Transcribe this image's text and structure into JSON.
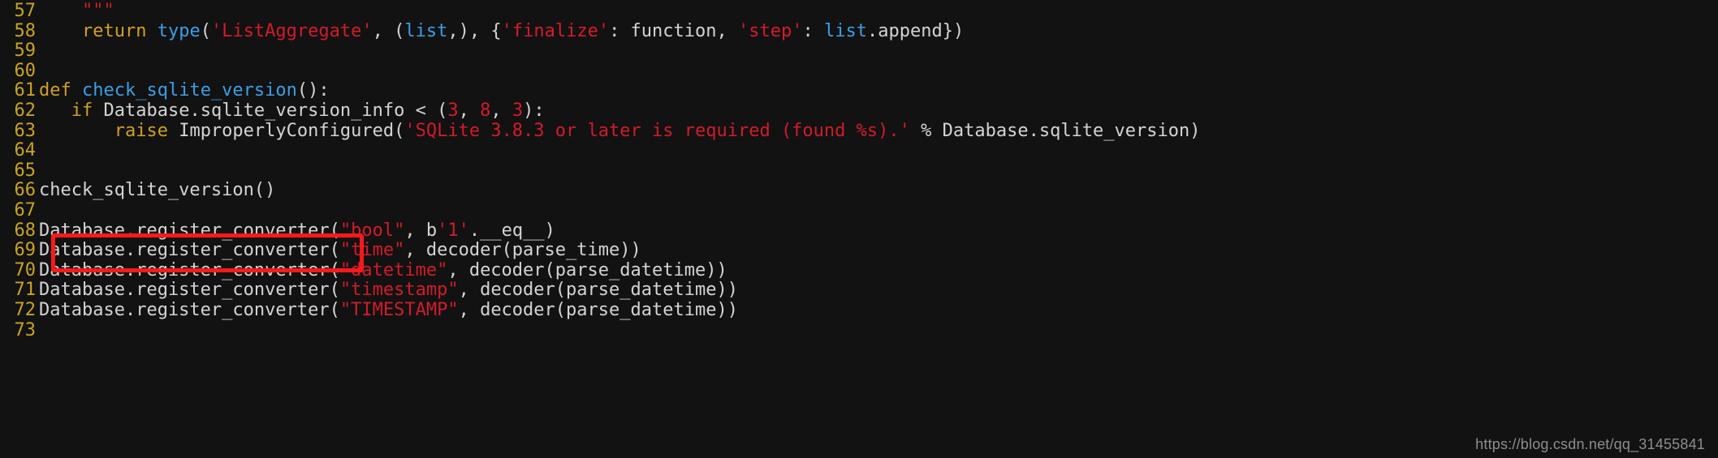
{
  "editor": {
    "language": "python",
    "background_color": "#121212",
    "gutter_color": "#c8a422",
    "default_text_color": "#d4d4d4",
    "keyword_color": "#cfa023",
    "string_color": "#d01c2a",
    "number_color": "#d01c2a",
    "function_color": "#3c9ee5",
    "first_line_number": 57,
    "last_line_number": 73
  },
  "annotation": {
    "type": "rectangle",
    "color": "#ff1a1a",
    "target_line": 66,
    "target_text": "check_sqlite_version()"
  },
  "watermark": {
    "text": "https://blog.csdn.net/qq_31455841"
  },
  "lines": [
    {
      "number": "57",
      "text": "    \"\"\"",
      "tokens": [
        {
          "t": "    ",
          "c": "t-def"
        },
        {
          "t": "\"\"\"",
          "c": "t-str"
        }
      ]
    },
    {
      "number": "58",
      "text": "    return type('ListAggregate', (list,), {'finalize': function, 'step': list.append})",
      "tokens": [
        {
          "t": "    ",
          "c": "t-def"
        },
        {
          "t": "return",
          "c": "t-kw"
        },
        {
          "t": " ",
          "c": "t-def"
        },
        {
          "t": "type",
          "c": "t-fn"
        },
        {
          "t": "(",
          "c": "t-punc"
        },
        {
          "t": "'ListAggregate'",
          "c": "t-str"
        },
        {
          "t": ", (",
          "c": "t-punc"
        },
        {
          "t": "list",
          "c": "t-fn"
        },
        {
          "t": ",), {",
          "c": "t-punc"
        },
        {
          "t": "'finalize'",
          "c": "t-str"
        },
        {
          "t": ": function, ",
          "c": "t-def"
        },
        {
          "t": "'step'",
          "c": "t-str"
        },
        {
          "t": ": ",
          "c": "t-def"
        },
        {
          "t": "list",
          "c": "t-fn"
        },
        {
          "t": ".append})",
          "c": "t-def"
        }
      ]
    },
    {
      "number": "59",
      "text": "",
      "tokens": []
    },
    {
      "number": "60",
      "text": "",
      "tokens": []
    },
    {
      "number": "61",
      "text": "def check_sqlite_version():",
      "tokens": [
        {
          "t": "def",
          "c": "t-kw"
        },
        {
          "t": " ",
          "c": "t-def"
        },
        {
          "t": "check_sqlite_version",
          "c": "t-fn"
        },
        {
          "t": "():",
          "c": "t-def"
        }
      ]
    },
    {
      "number": "62",
      "text": "   if Database.sqlite_version_info < (3, 8, 3):",
      "tokens": [
        {
          "t": "   ",
          "c": "t-def"
        },
        {
          "t": "if",
          "c": "t-kw"
        },
        {
          "t": " Database.sqlite_version_info < (",
          "c": "t-def"
        },
        {
          "t": "3",
          "c": "t-num"
        },
        {
          "t": ", ",
          "c": "t-def"
        },
        {
          "t": "8",
          "c": "t-num"
        },
        {
          "t": ", ",
          "c": "t-def"
        },
        {
          "t": "3",
          "c": "t-num"
        },
        {
          "t": "):",
          "c": "t-def"
        }
      ]
    },
    {
      "number": "63",
      "text": "       raise ImproperlyConfigured('SQLite 3.8.3 or later is required (found %s).' % Database.sqlite_version)",
      "tokens": [
        {
          "t": "       ",
          "c": "t-def"
        },
        {
          "t": "raise",
          "c": "t-kw"
        },
        {
          "t": " ImproperlyConfigured(",
          "c": "t-def"
        },
        {
          "t": "'SQLite 3.8.3 or later is required (found %s).'",
          "c": "t-str"
        },
        {
          "t": " % Database.sqlite_version)",
          "c": "t-def"
        }
      ]
    },
    {
      "number": "64",
      "text": "",
      "tokens": []
    },
    {
      "number": "65",
      "text": "",
      "tokens": []
    },
    {
      "number": "66",
      "text": "check_sqlite_version()",
      "tokens": [
        {
          "t": "check_sqlite_version()",
          "c": "t-def"
        }
      ]
    },
    {
      "number": "67",
      "text": "",
      "tokens": []
    },
    {
      "number": "68",
      "text": "Database.register_converter(\"bool\", b'1'.__eq__)",
      "tokens": [
        {
          "t": "Database.register_converter(",
          "c": "t-def"
        },
        {
          "t": "\"bool\"",
          "c": "t-str"
        },
        {
          "t": ", b",
          "c": "t-def"
        },
        {
          "t": "'1'",
          "c": "t-str"
        },
        {
          "t": ".__eq__)",
          "c": "t-def"
        }
      ]
    },
    {
      "number": "69",
      "text": "Database.register_converter(\"time\", decoder(parse_time))",
      "tokens": [
        {
          "t": "Database.register_converter(",
          "c": "t-def"
        },
        {
          "t": "\"time\"",
          "c": "t-str"
        },
        {
          "t": ", decoder(parse_time))",
          "c": "t-def"
        }
      ]
    },
    {
      "number": "70",
      "text": "Database.register_converter(\"datetime\", decoder(parse_datetime))",
      "tokens": [
        {
          "t": "Database.register_converter(",
          "c": "t-def"
        },
        {
          "t": "\"datetime\"",
          "c": "t-str"
        },
        {
          "t": ", decoder(parse_datetime))",
          "c": "t-def"
        }
      ]
    },
    {
      "number": "71",
      "text": "Database.register_converter(\"timestamp\", decoder(parse_datetime))",
      "tokens": [
        {
          "t": "Database.register_converter(",
          "c": "t-def"
        },
        {
          "t": "\"timestamp\"",
          "c": "t-str"
        },
        {
          "t": ", decoder(parse_datetime))",
          "c": "t-def"
        }
      ]
    },
    {
      "number": "72",
      "text": "Database.register_converter(\"TIMESTAMP\", decoder(parse_datetime))",
      "tokens": [
        {
          "t": "Database.register_converter(",
          "c": "t-def"
        },
        {
          "t": "\"TIMESTAMP\"",
          "c": "t-str"
        },
        {
          "t": ", decoder(parse_datetime))",
          "c": "t-def"
        }
      ]
    },
    {
      "number": "73",
      "text": "",
      "tokens": []
    }
  ]
}
